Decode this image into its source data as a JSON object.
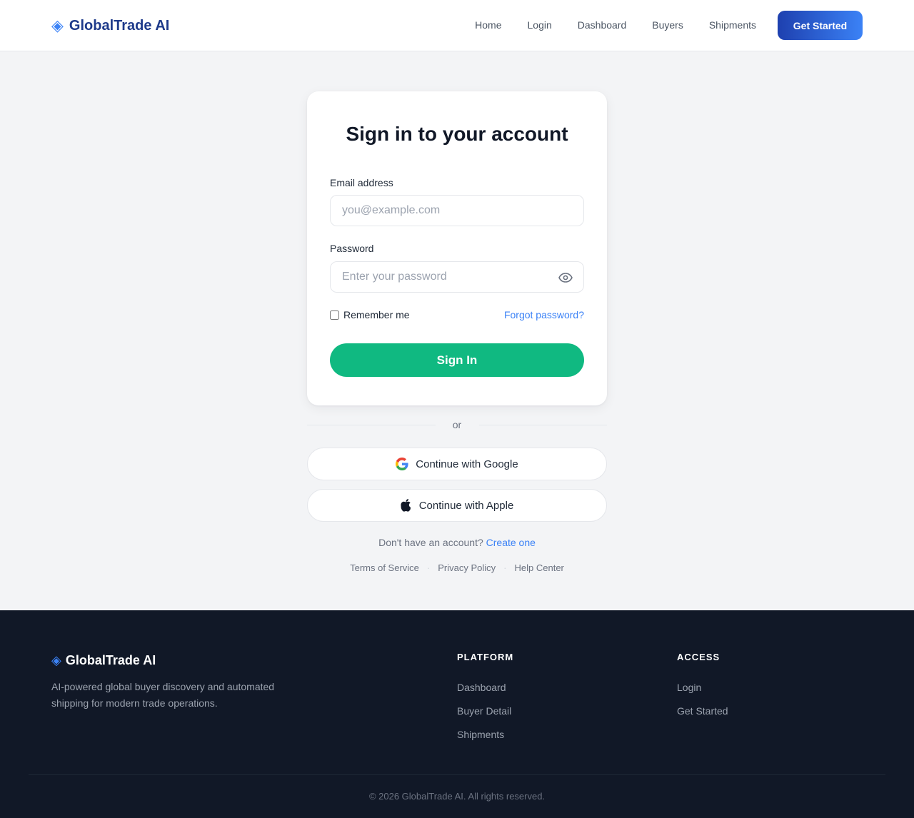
{
  "header": {
    "brand_name": "GlobalTrade AI",
    "brand_icon": "diamond-logo-icon",
    "nav": [
      "Home",
      "Login",
      "Dashboard",
      "Buyers",
      "Shipments"
    ],
    "cta_label": "Get Started"
  },
  "login": {
    "title": "Sign in to your account",
    "email_label": "Email address",
    "email_placeholder": "you@example.com",
    "password_label": "Password",
    "password_placeholder": "Enter your password",
    "remember_label": "Remember me",
    "forgot_label": "Forgot password?",
    "signin_label": "Sign In"
  },
  "divider_text": "or",
  "social": {
    "google_label": "Continue with Google",
    "apple_label": "Continue with Apple"
  },
  "signup": {
    "prompt": "Don't have an account?",
    "link": "Create one"
  },
  "legal": [
    "Terms of Service",
    "Privacy Policy",
    "Help Center"
  ],
  "footer": {
    "brand_name": "GlobalTrade AI",
    "description": "AI-powered global buyer discovery and automated shipping for modern trade operations.",
    "platform_heading": "PLATFORM",
    "platform_links": [
      "Dashboard",
      "Buyer Detail",
      "Shipments"
    ],
    "access_heading": "ACCESS",
    "access_links": [
      "Login",
      "Get Started"
    ],
    "copyright": "© 2026 GlobalTrade AI. All rights reserved."
  },
  "colors": {
    "brand_blue": "#1e3a8a",
    "accent_blue": "#3b82f6",
    "primary_green": "#10b981",
    "footer_bg": "#111827",
    "page_bg": "#f3f4f6"
  }
}
